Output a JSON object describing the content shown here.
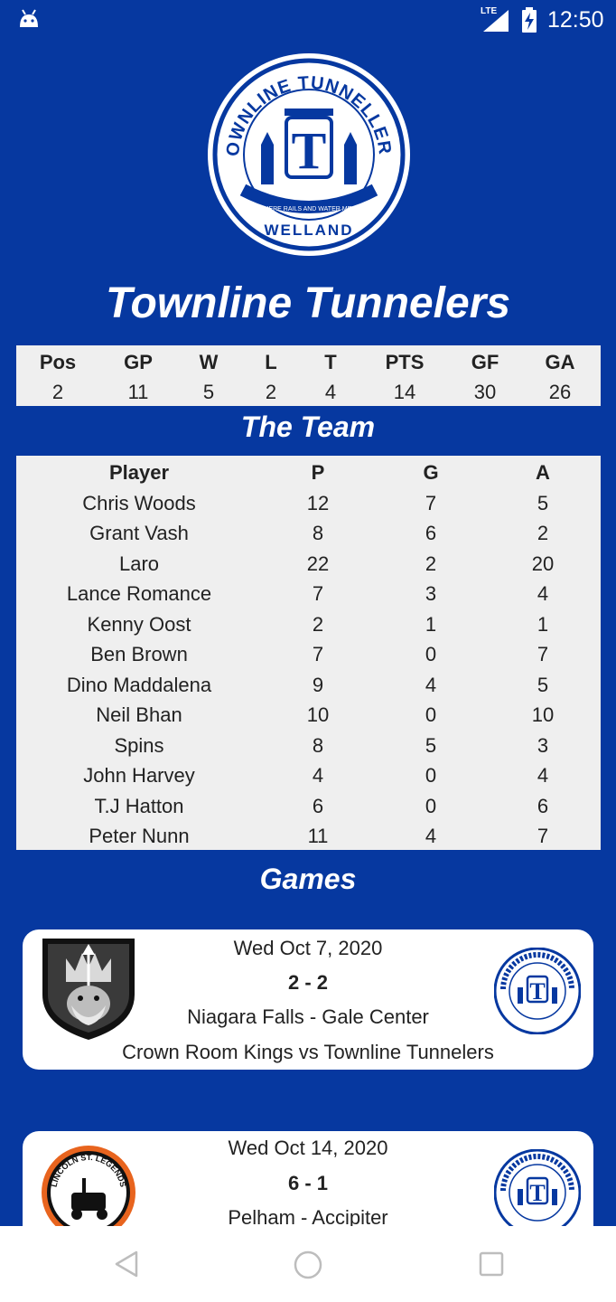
{
  "status_bar": {
    "time": "12:50",
    "network": "LTE",
    "icons": [
      "android-icon",
      "signal-icon",
      "battery-charging-icon"
    ]
  },
  "team": {
    "name": "Townline Tunnelers",
    "logo_text": {
      "top": "TOWNLINE TUNNELLERS",
      "letter": "T",
      "ribbon": "WHERE RAILS AND WATER MEET",
      "bottom": "WELLAND"
    }
  },
  "standings": {
    "headers": [
      "Pos",
      "GP",
      "W",
      "L",
      "T",
      "PTS",
      "GF",
      "GA"
    ],
    "values": [
      "2",
      "11",
      "5",
      "2",
      "4",
      "14",
      "30",
      "26"
    ]
  },
  "roster": {
    "title": "The Team",
    "headers": [
      "Player",
      "P",
      "G",
      "A"
    ],
    "rows": [
      [
        "Chris Woods",
        "12",
        "7",
        "5"
      ],
      [
        "Grant Vash",
        "8",
        "6",
        "2"
      ],
      [
        "Laro",
        "22",
        "2",
        "20"
      ],
      [
        "Lance Romance",
        "7",
        "3",
        "4"
      ],
      [
        "Kenny Oost",
        "2",
        "1",
        "1"
      ],
      [
        "Ben Brown",
        "7",
        "0",
        "7"
      ],
      [
        "Dino Maddalena",
        "9",
        "4",
        "5"
      ],
      [
        "Neil Bhan",
        "10",
        "0",
        "10"
      ],
      [
        "Spins",
        "8",
        "5",
        "3"
      ],
      [
        "John Harvey",
        "4",
        "0",
        "4"
      ],
      [
        "T.J Hatton",
        "6",
        "0",
        "6"
      ],
      [
        "Peter Nunn",
        "11",
        "4",
        "7"
      ]
    ]
  },
  "games": {
    "title": "Games",
    "items": [
      {
        "date": "Wed Oct 7, 2020",
        "score": "2 - 2",
        "venue": "Niagara Falls - Gale Center",
        "matchup": "Crown Room Kings vs Townline Tunnelers",
        "opponent_logo": "trident-king-shield-icon"
      },
      {
        "date": "Wed Oct 14, 2020",
        "score": "6 - 1",
        "venue": "Pelham - Accipiter",
        "matchup": "",
        "opponent_logo": "lincoln-st-legends-icon",
        "opponent_logo_text": "LINCOLN ST. LEGENDS"
      }
    ]
  },
  "colors": {
    "background": "#0638a0",
    "card": "#ffffff",
    "table": "#efefef",
    "accent_orange": "#e8641e"
  }
}
